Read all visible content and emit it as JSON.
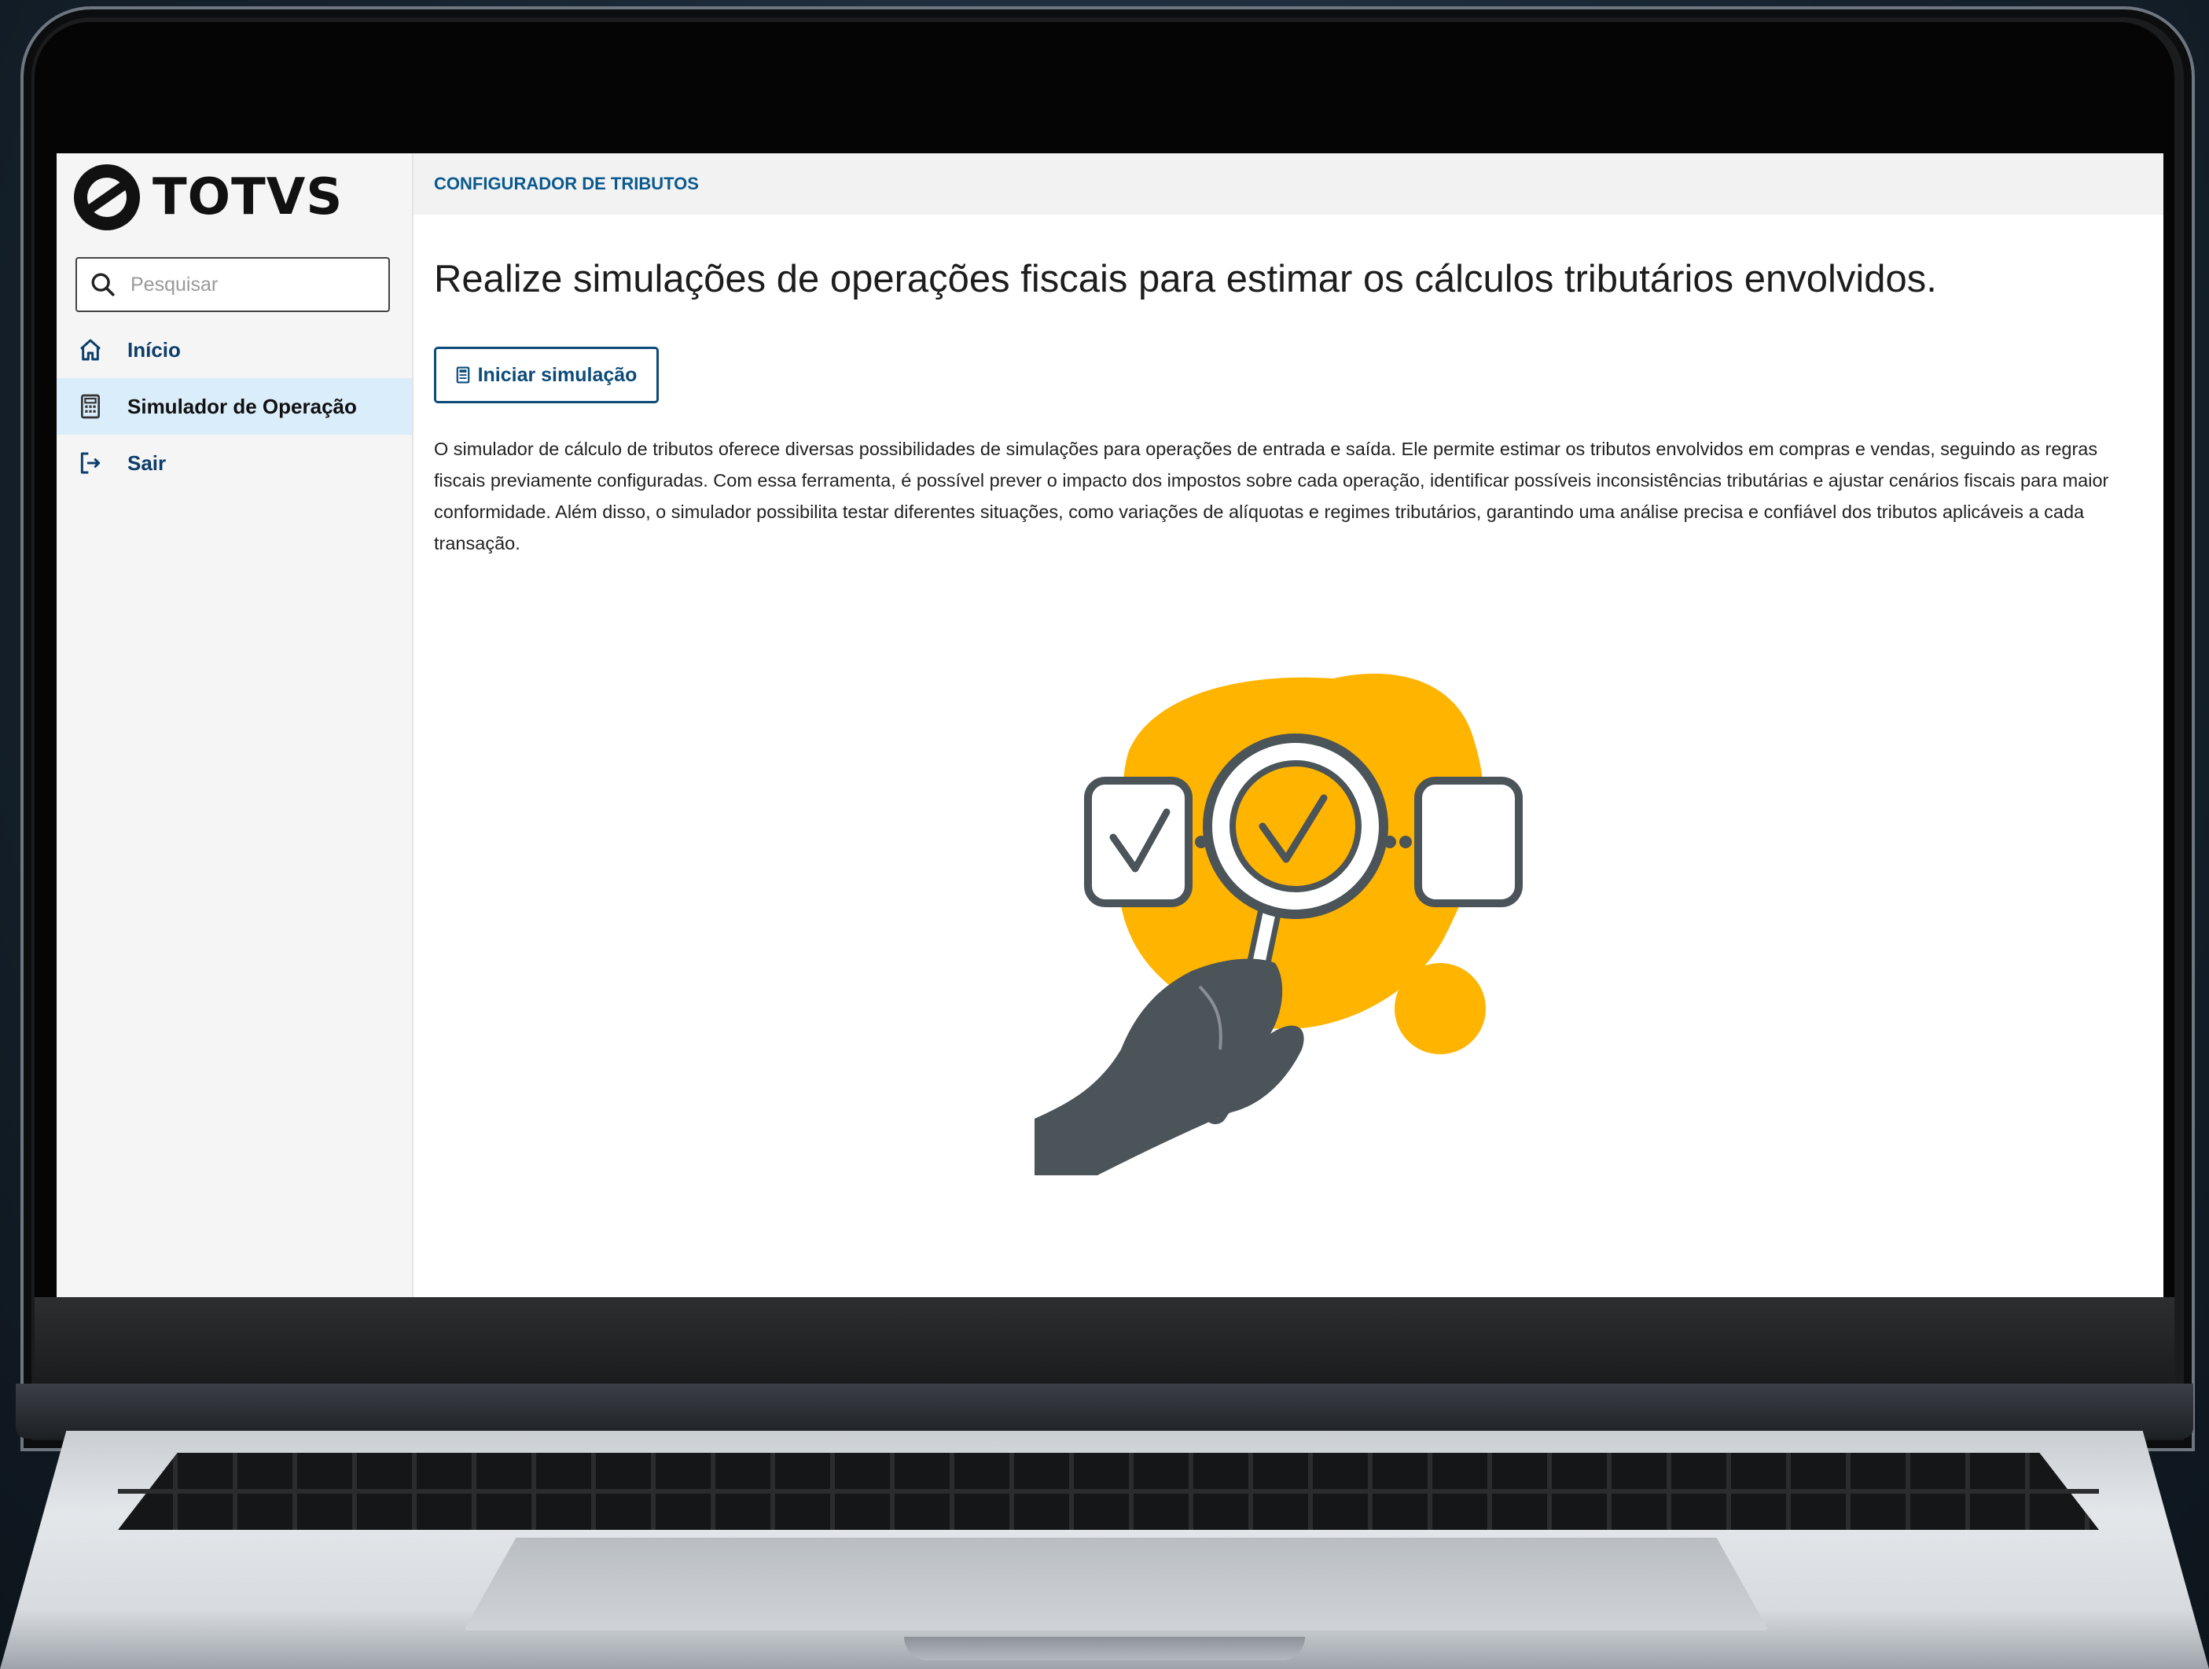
{
  "app": {
    "logo_text": "TOTVS"
  },
  "search": {
    "placeholder": "Pesquisar"
  },
  "sidebar": {
    "items": [
      {
        "label": "Início",
        "icon": "home-icon",
        "active": false
      },
      {
        "label": "Simulador de Operação",
        "icon": "calculator-icon",
        "active": true
      },
      {
        "label": "Sair",
        "icon": "logout-icon",
        "active": false
      }
    ]
  },
  "header": {
    "breadcrumb": "CONFIGURADOR DE TRIBUTOS"
  },
  "main": {
    "title": "Realize simulações de operações fiscais para estimar os cálculos tributários envolvidos.",
    "start_button_label": "Iniciar simulação",
    "start_button_icon": "calculator-icon",
    "description": "O simulador de cálculo de tributos oferece diversas possibilidades de simulações para operações de entrada e saída. Ele permite estimar os tributos envolvidos em compras e vendas, seguindo as regras fiscais previamente configuradas. Com essa ferramenta, é possível prever o impacto dos impostos sobre cada operação, identificar possíveis inconsistências tributárias e ajustar cenários fiscais para maior conformidade. Além disso, o simulador possibilita testar diferentes situações, como variações de alíquotas e regimes tributários, garantindo uma análise precisa e confiável dos tributos aplicáveis a cada transação.",
    "illustration": "magnifier-check-illustration"
  },
  "colors": {
    "accent": "#0c4b7a",
    "active_nav_bg": "#daedfa",
    "illustration_yellow": "#ffb400",
    "illustration_dark": "#4a5459"
  }
}
